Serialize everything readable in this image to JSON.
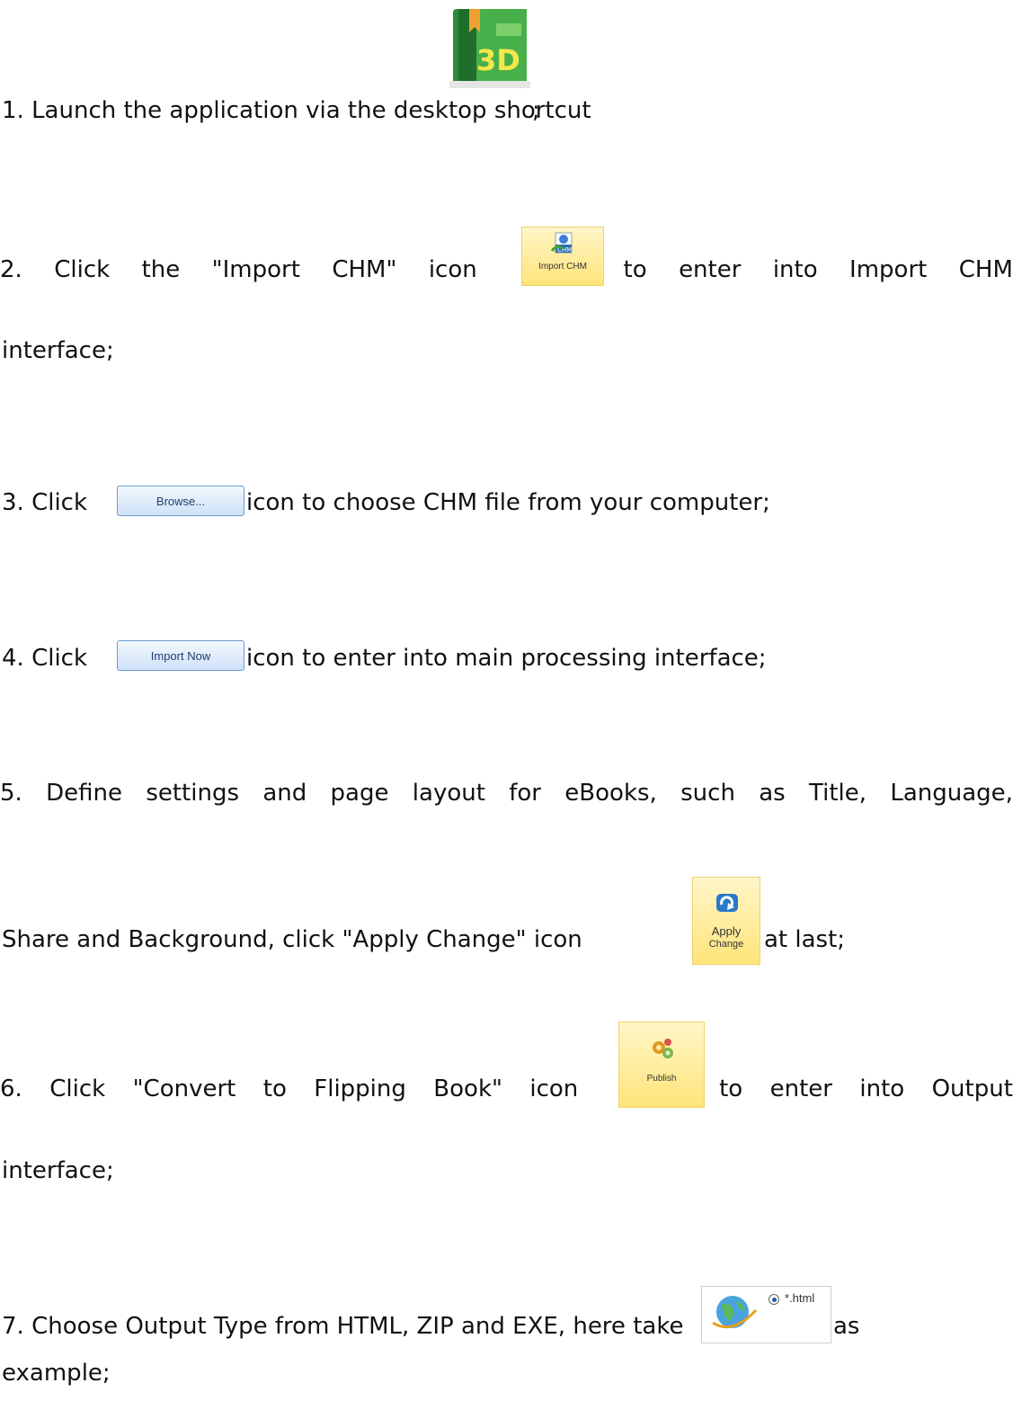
{
  "steps": {
    "s1": {
      "before": "1. Launch the application via the desktop shortcut",
      "after": ";"
    },
    "s2": {
      "words": [
        "2.",
        "Click",
        "the",
        "\"Import",
        "CHM\"",
        "icon",
        "",
        "to",
        "enter",
        "into",
        "Import",
        "CHM"
      ],
      "line2": "interface;"
    },
    "s3": {
      "before": "3. Click",
      "after": "icon to choose CHM file from your computer;"
    },
    "s4": {
      "before": "4. Click",
      "after": "icon to enter into main processing interface;"
    },
    "s5": {
      "line1": [
        "5.",
        "Define",
        "settings",
        "and",
        "page",
        "layout",
        "for",
        "eBooks,",
        "such",
        "as",
        "Title,",
        "Language,"
      ],
      "before": "Share and Background, click \"Apply Change\" icon",
      "after": "at last;"
    },
    "s6": {
      "words": [
        "6.",
        "Click",
        "\"Convert",
        "to",
        "Flipping",
        "Book\"",
        "icon",
        "",
        "to",
        "enter",
        "into",
        "Output"
      ],
      "line2": "interface;"
    },
    "s7": {
      "before": "7. Choose Output Type from HTML, ZIP and EXE, here take",
      "after": "as",
      "line2": "example;"
    }
  },
  "icons": {
    "app_icon_text": "3D",
    "import_chm_label": "Import CHM",
    "import_chm_badge": "CHM",
    "browse_label": "Browse...",
    "import_now_label": "Import Now",
    "apply_label_1": "Apply",
    "apply_label_2": "Change",
    "publish_label": "Publish",
    "html_option": "*.html"
  },
  "colors": {
    "ribbon_yellow": "#ffe47a",
    "app_green": "#3fa83c",
    "button_blue": "#cfe1f7"
  }
}
